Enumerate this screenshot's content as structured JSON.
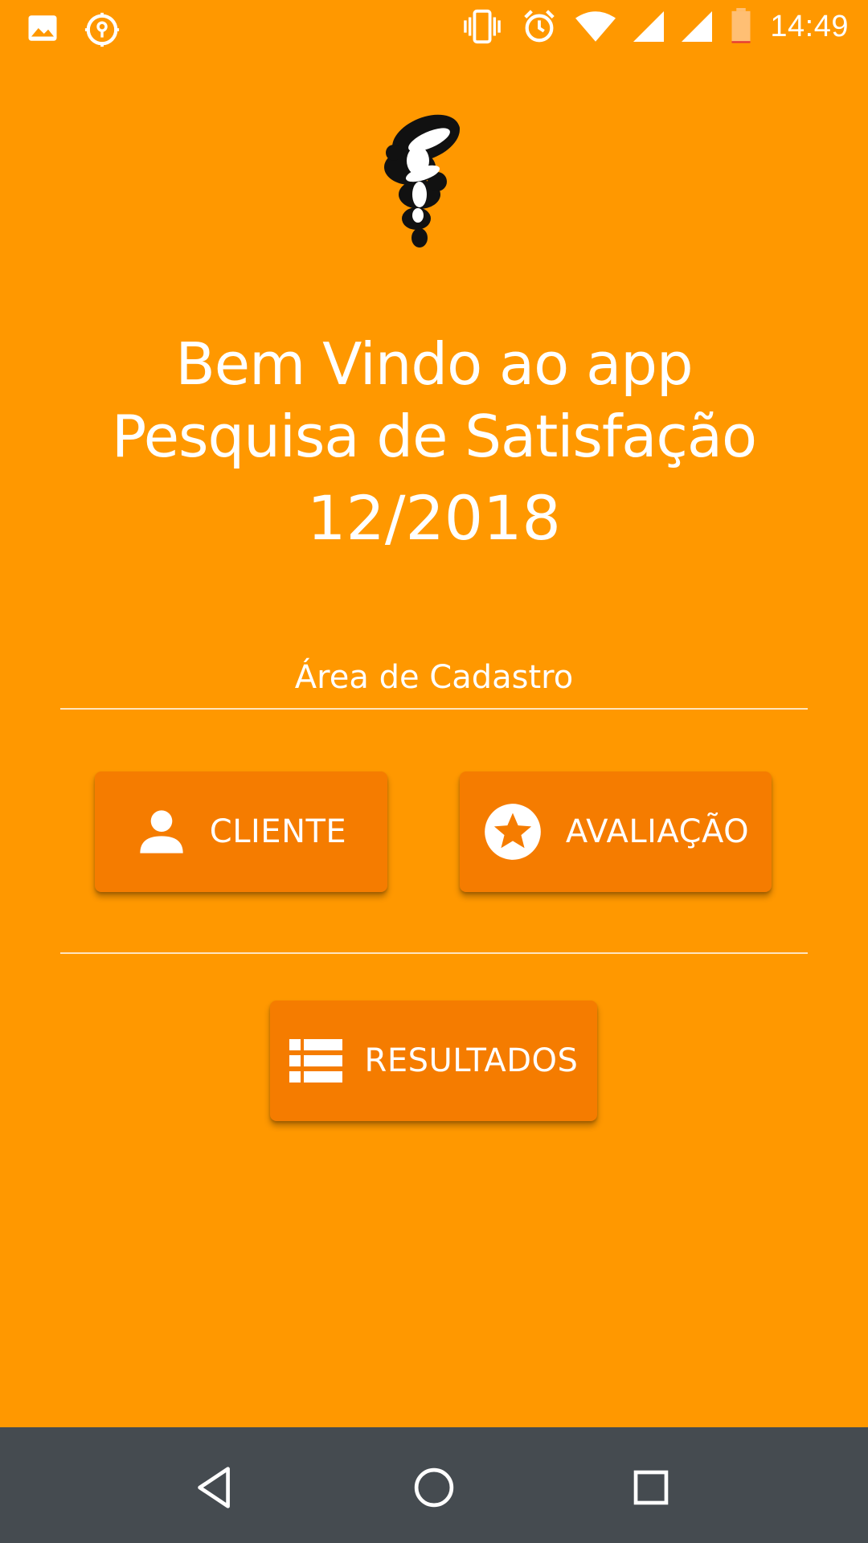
{
  "status_bar": {
    "time": "14:49",
    "left_icons": [
      "image-icon",
      "location-icon"
    ],
    "right_icons": [
      "vibrate-icon",
      "alarm-icon",
      "wifi-icon",
      "signal-icon",
      "signal-icon",
      "battery-icon"
    ]
  },
  "welcome": {
    "line1": "Bem Vindo ao app",
    "line2": "Pesquisa de Satisfação",
    "date": "12/2018"
  },
  "section": {
    "label": "Área de Cadastro"
  },
  "buttons": {
    "cliente": {
      "label": "CLIENTE",
      "icon": "person-icon"
    },
    "avaliacao": {
      "label": "AVALIAÇÃO",
      "icon": "star-circle-icon"
    },
    "resultados": {
      "label": "RESULTADOS",
      "icon": "list-icon"
    }
  },
  "nav_bar": {
    "buttons": [
      "back-icon",
      "home-icon",
      "recent-apps-icon"
    ]
  },
  "colors": {
    "background": "#FF9800",
    "button": "#F57C00",
    "nav_bar": "#454B50",
    "text": "#FFFFFF"
  }
}
